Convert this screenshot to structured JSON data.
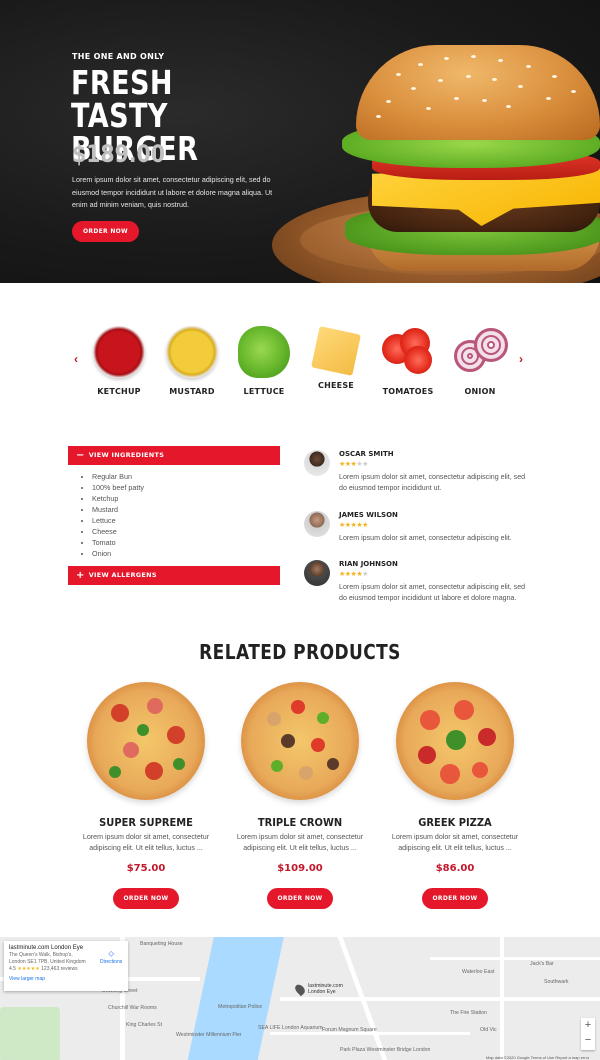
{
  "hero": {
    "kicker": "THE ONE AND ONLY",
    "title": "FRESH TASTY BURGER",
    "price": "$189.00",
    "description": "Lorem ipsum dolor sit amet, consectetur adipiscing elit, sed do eiusmod tempor incididunt ut labore et dolore magna aliqua. Ut enim ad minim veniam, quis nostrud.",
    "cta_label": "ORDER NOW"
  },
  "ingredients_carousel": {
    "prev_icon": "chevron-left-icon",
    "next_icon": "chevron-right-icon",
    "items": [
      {
        "label": "KETCHUP"
      },
      {
        "label": "MUSTARD"
      },
      {
        "label": "LETTUCE"
      },
      {
        "label": "CHEESE"
      },
      {
        "label": "TOMATOES"
      },
      {
        "label": "ONION"
      }
    ]
  },
  "accordion": {
    "ingredients_label": "VIEW INGREDIENTS",
    "ingredients_symbol": "−",
    "ingredients": [
      "Regular Bun",
      "100% beef patty",
      "Ketchup",
      "Mustard",
      "Lettuce",
      "Cheese",
      "Tomato",
      "Onion"
    ],
    "allergens_label": "VIEW ALLERGENS",
    "allergens_symbol": "+"
  },
  "reviews": [
    {
      "name": "OSCAR SMITH",
      "rating": 3,
      "text": "Lorem ipsum dolor sit amet, consectetur adipiscing elit, sed do eiusmod tempor incididunt ut."
    },
    {
      "name": "JAMES WILSON",
      "rating": 5,
      "text": "Lorem ipsum dolor sit amet, consectetur adipiscing elit."
    },
    {
      "name": "RIAN JOHNSON",
      "rating": 4,
      "text": "Lorem ipsum dolor sit amet, consectetur adipiscing elit, sed do eiusmod tempor incididunt ut labore et dolore magna."
    }
  ],
  "related": {
    "title": "RELATED PRODUCTS",
    "products": [
      {
        "name": "SUPER SUPREME",
        "description": "Lorem ipsum dolor sit amet, consectetur adipiscing elit. Ut elit tellus, luctus ...",
        "price": "$75.00",
        "cta_label": "ORDER NOW"
      },
      {
        "name": "TRIPLE CROWN",
        "description": "Lorem ipsum dolor sit amet, consectetur adipiscing elit. Ut elit tellus, luctus ...",
        "price": "$109.00",
        "cta_label": "ORDER NOW"
      },
      {
        "name": "GREEK PIZZA",
        "description": "Lorem ipsum dolor sit amet, consectetur adipiscing elit. Ut elit tellus, luctus ...",
        "price": "$86.00",
        "cta_label": "ORDER NOW"
      }
    ]
  },
  "map": {
    "place_name": "lastminute.com London Eye",
    "address": "The Queen's Walk, Bishop's, London SE1 7PB, United Kingdom",
    "rating": "4.5",
    "stars": "★★★★★",
    "reviews": "123,463 reviews",
    "directions_label": "Directions",
    "larger_map_label": "View larger map",
    "pin_label": "lastminute.com London Eye",
    "zoom_in": "+",
    "zoom_out": "−",
    "footer": "Map data ©2020 Google   Terms of Use   Report a map error",
    "labels": [
      "Banqueting House",
      "Waterloo East",
      "Jack's Bar",
      "Downing Street",
      "Metropolitan Police",
      "Churchill War Rooms",
      "Westminster Millennium Pier",
      "SEA LIFE London Aquarium",
      "Forum Magnum Square",
      "The Fire Station",
      "Old Vic",
      "Southwark",
      "Park Plaza Westminster Bridge London",
      "King Charles St"
    ]
  },
  "colors": {
    "accent": "#e4172b",
    "price": "#c2182b",
    "star": "#f3b31a"
  }
}
